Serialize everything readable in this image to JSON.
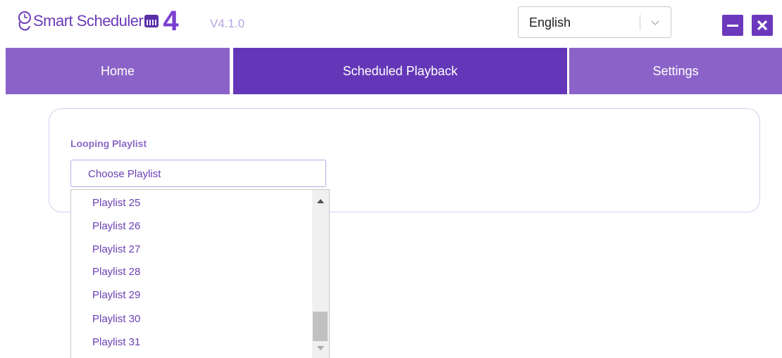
{
  "app": {
    "logo_text": "Smart Scheduler",
    "logo_number": "4",
    "version": "V4.1.0"
  },
  "language": {
    "selected": "English"
  },
  "window_controls": {
    "minimize_icon": "minimize-icon",
    "close_icon": "close-icon"
  },
  "nav": {
    "tabs": [
      {
        "label": "Home",
        "active": false
      },
      {
        "label": "Scheduled Playback",
        "active": true
      },
      {
        "label": "Settings",
        "active": false
      }
    ]
  },
  "looping": {
    "label": "Looping Playlist",
    "placeholder": "Choose Playlist",
    "options": [
      "Playlist 25",
      "Playlist 26",
      "Playlist 27",
      "Playlist 28",
      "Playlist 29",
      "Playlist 30",
      "Playlist 31"
    ]
  },
  "colors": {
    "accent": "#6437b8",
    "tab": "#8b63c8",
    "text_accent": "#6a3fb3"
  }
}
